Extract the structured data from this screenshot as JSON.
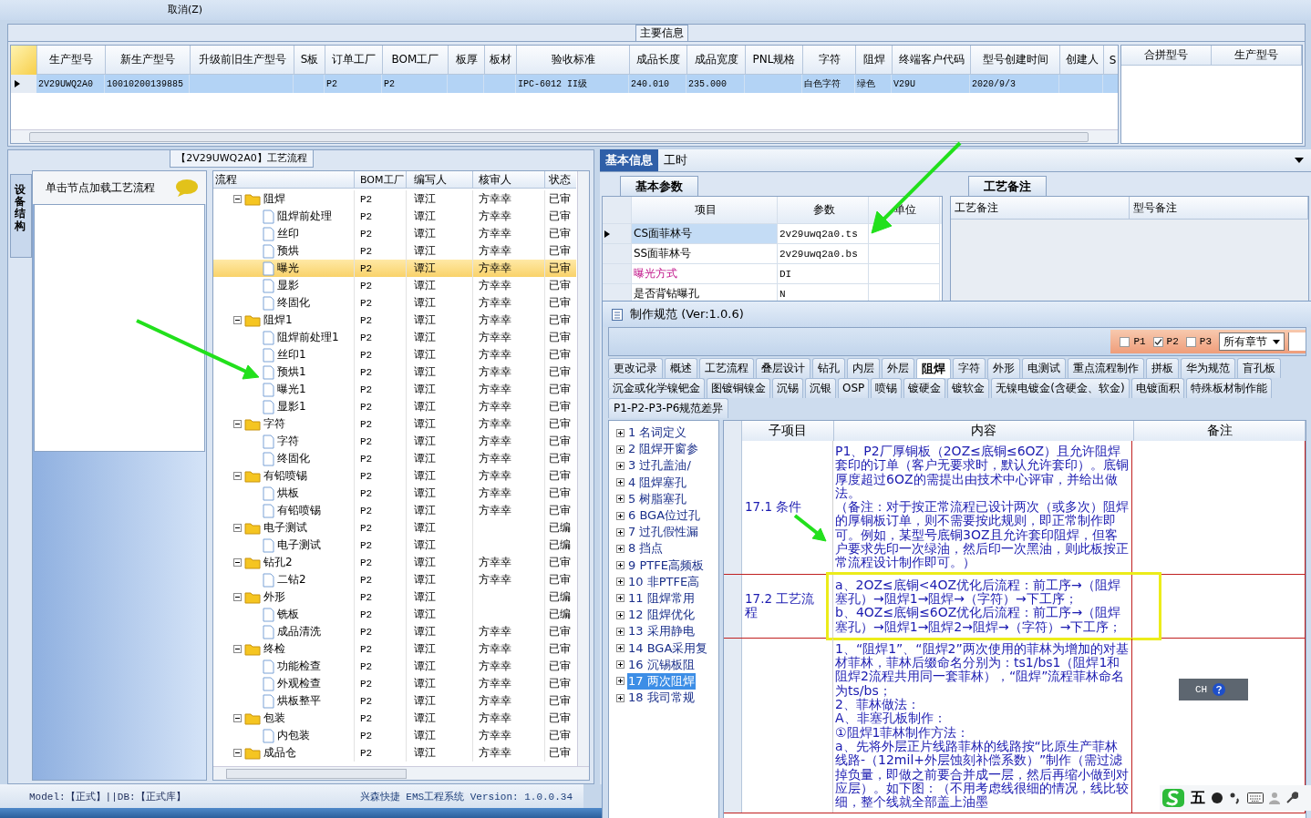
{
  "toolbar": {
    "cancel_button": "取消(Z)"
  },
  "main_info": {
    "tab": "主要信息",
    "columns": [
      "生产型号",
      "新生产型号",
      "升级前旧生产型号",
      "S板",
      "订单工厂",
      "BOM工厂",
      "板厚",
      "板材",
      "验收标准",
      "成品长度",
      "成品宽度",
      "PNL规格",
      "字符",
      "阻焊",
      "终端客户代码",
      "型号创建时间",
      "创建人",
      "S"
    ],
    "rows": [
      {
        "selected": true,
        "cells": [
          "2V29UWQ2A0",
          "10010200139885",
          null,
          null,
          "P2",
          "P2",
          null,
          null,
          "IPC-6012 II级",
          "240.010",
          "235.000",
          null,
          "白色字符",
          "绿色",
          "V29U",
          "2020/9/3",
          null,
          null
        ]
      }
    ],
    "merge_columns": [
      "合拼型号",
      "生产型号"
    ]
  },
  "process": {
    "title": "【2V29UWQ2A0】工艺流程",
    "side_tab": "设备结构",
    "hint": "单击节点加载工艺流程",
    "columns": [
      "流程",
      "BOM工厂",
      "编写人",
      "核审人",
      "状态"
    ],
    "tree": [
      {
        "name": "阻焊",
        "factory": "P2",
        "writer": "谭江",
        "reviewer": "方幸幸",
        "status": "已审",
        "selected": false,
        "children": [
          {
            "name": "阻焊前处理",
            "factory": "P2",
            "writer": "谭江",
            "reviewer": "方幸幸",
            "status": "已审",
            "selected": false
          },
          {
            "name": "丝印",
            "factory": "P2",
            "writer": "谭江",
            "reviewer": "方幸幸",
            "status": "已审",
            "selected": false
          },
          {
            "name": "预烘",
            "factory": "P2",
            "writer": "谭江",
            "reviewer": "方幸幸",
            "status": "已审",
            "selected": false
          },
          {
            "name": "曝光",
            "factory": "P2",
            "writer": "谭江",
            "reviewer": "方幸幸",
            "status": "已审",
            "selected": true
          },
          {
            "name": "显影",
            "factory": "P2",
            "writer": "谭江",
            "reviewer": "方幸幸",
            "status": "已审",
            "selected": false
          },
          {
            "name": "终固化",
            "factory": "P2",
            "writer": "谭江",
            "reviewer": "方幸幸",
            "status": "已审",
            "selected": false
          }
        ]
      },
      {
        "name": "阻焊1",
        "factory": "P2",
        "writer": "谭江",
        "reviewer": "方幸幸",
        "status": "已审",
        "selected": false,
        "children": [
          {
            "name": "阻焊前处理1",
            "factory": "P2",
            "writer": "谭江",
            "reviewer": "方幸幸",
            "status": "已审",
            "selected": false
          },
          {
            "name": "丝印1",
            "factory": "P2",
            "writer": "谭江",
            "reviewer": "方幸幸",
            "status": "已审",
            "selected": false
          },
          {
            "name": "预烘1",
            "factory": "P2",
            "writer": "谭江",
            "reviewer": "方幸幸",
            "status": "已审",
            "selected": false
          },
          {
            "name": "曝光1",
            "factory": "P2",
            "writer": "谭江",
            "reviewer": "方幸幸",
            "status": "已审",
            "selected": false
          },
          {
            "name": "显影1",
            "factory": "P2",
            "writer": "谭江",
            "reviewer": "方幸幸",
            "status": "已审",
            "selected": false
          }
        ]
      },
      {
        "name": "字符",
        "factory": "P2",
        "writer": "谭江",
        "reviewer": "方幸幸",
        "status": "已审",
        "selected": false,
        "children": [
          {
            "name": "字符",
            "factory": "P2",
            "writer": "谭江",
            "reviewer": "方幸幸",
            "status": "已审",
            "selected": false
          },
          {
            "name": "终固化",
            "factory": "P2",
            "writer": "谭江",
            "reviewer": "方幸幸",
            "status": "已审",
            "selected": false
          }
        ]
      },
      {
        "name": "有铅喷锡",
        "factory": "P2",
        "writer": "谭江",
        "reviewer": "方幸幸",
        "status": "已审",
        "selected": false,
        "children": [
          {
            "name": "烘板",
            "factory": "P2",
            "writer": "谭江",
            "reviewer": "方幸幸",
            "status": "已审",
            "selected": false
          },
          {
            "name": "有铅喷锡",
            "factory": "P2",
            "writer": "谭江",
            "reviewer": "方幸幸",
            "status": "已审",
            "selected": false
          }
        ]
      },
      {
        "name": "电子测试",
        "factory": "P2",
        "writer": "谭江",
        "status": "已编",
        "selected": false,
        "children": [
          {
            "name": "电子测试",
            "factory": "P2",
            "writer": "谭江",
            "status": "已编",
            "selected": false
          }
        ]
      },
      {
        "name": "钻孔2",
        "factory": "P2",
        "writer": "谭江",
        "reviewer": "方幸幸",
        "status": "已审",
        "selected": false,
        "children": [
          {
            "name": "二钻2",
            "factory": "P2",
            "writer": "谭江",
            "reviewer": "方幸幸",
            "status": "已审",
            "selected": false
          }
        ]
      },
      {
        "name": "外形",
        "factory": "P2",
        "writer": "谭江",
        "status": "已编",
        "selected": false,
        "children": [
          {
            "name": "铣板",
            "factory": "P2",
            "writer": "谭江",
            "status": "已编",
            "selected": false
          },
          {
            "name": "成品清洗",
            "factory": "P2",
            "writer": "谭江",
            "reviewer": "方幸幸",
            "status": "已审",
            "selected": false
          }
        ]
      },
      {
        "name": "终检",
        "factory": "P2",
        "writer": "谭江",
        "reviewer": "方幸幸",
        "status": "已审",
        "selected": false,
        "children": [
          {
            "name": "功能检查",
            "factory": "P2",
            "writer": "谭江",
            "reviewer": "方幸幸",
            "status": "已审",
            "selected": false
          },
          {
            "name": "外观检查",
            "factory": "P2",
            "writer": "谭江",
            "reviewer": "方幸幸",
            "status": "已审",
            "selected": false
          },
          {
            "name": "烘板整平",
            "factory": "P2",
            "writer": "谭江",
            "reviewer": "方幸幸",
            "status": "已审",
            "selected": false
          }
        ]
      },
      {
        "name": "包装",
        "factory": "P2",
        "writer": "谭江",
        "reviewer": "方幸幸",
        "status": "已审",
        "selected": false,
        "children": [
          {
            "name": "内包装",
            "factory": "P2",
            "writer": "谭江",
            "reviewer": "方幸幸",
            "status": "已审",
            "selected": false
          }
        ]
      },
      {
        "name": "成品仓",
        "factory": "P2",
        "writer": "谭江",
        "reviewer": "方幸幸",
        "status": "已审",
        "selected": false
      }
    ]
  },
  "detail": {
    "tabs": [
      {
        "label": "基本信息",
        "selected": true
      },
      {
        "label": "工时",
        "selected": false
      }
    ],
    "params_tab": "基本参数",
    "param_columns": [
      "项目",
      "参数",
      "单位"
    ],
    "params": [
      {
        "item": "CS面菲林号",
        "value": "2v29uwq2a0.ts",
        "selected": true,
        "emphasis": false
      },
      {
        "item": "SS面菲林号",
        "value": "2v29uwq2a0.bs",
        "selected": false,
        "emphasis": false
      },
      {
        "item": "曝光方式",
        "value": "DI",
        "selected": false,
        "emphasis": true
      },
      {
        "item": "是否背钻曝孔",
        "value": "N",
        "selected": false,
        "emphasis": false
      }
    ],
    "notes_tab": "工艺备注",
    "note_columns": [
      "工艺备注",
      "型号备注"
    ]
  },
  "spec_window": {
    "title": "制作规范 (Ver:1.0.6)",
    "filters": [
      {
        "label": "P1",
        "checked": false
      },
      {
        "label": "P2",
        "checked": true
      },
      {
        "label": "P3",
        "checked": false
      }
    ],
    "chapter_select": "所有章节",
    "tab_rows": [
      [
        {
          "label": "更改记录",
          "selected": false
        },
        {
          "label": "概述",
          "selected": false
        },
        {
          "label": "工艺流程",
          "selected": false
        },
        {
          "label": "叠层设计",
          "selected": false
        },
        {
          "label": "钻孔",
          "selected": false
        },
        {
          "label": "内层",
          "selected": false
        },
        {
          "label": "外层",
          "selected": false
        },
        {
          "label": "阻焊",
          "selected": true
        },
        {
          "label": "字符",
          "selected": false
        },
        {
          "label": "外形",
          "selected": false
        },
        {
          "label": "电测试",
          "selected": false
        },
        {
          "label": "重点流程制作",
          "selected": false
        },
        {
          "label": "拼板",
          "selected": false
        },
        {
          "label": "华为规范",
          "selected": false
        },
        {
          "label": "盲孔板",
          "selected": false
        }
      ],
      [
        {
          "label": "沉金或化学镍钯金",
          "selected": false
        },
        {
          "label": "图镀铜镍金",
          "selected": false
        },
        {
          "label": "沉锡",
          "selected": false
        },
        {
          "label": "沉银",
          "selected": false
        },
        {
          "label": "OSP",
          "selected": false
        },
        {
          "label": "喷锡",
          "selected": false
        },
        {
          "label": "镀硬金",
          "selected": false
        },
        {
          "label": "镀软金",
          "selected": false
        },
        {
          "label": "无镍电镀金(含硬金、软金)",
          "selected": false
        },
        {
          "label": "电镀面积",
          "selected": false
        },
        {
          "label": "特殊板材制作能",
          "selected": false
        }
      ],
      [
        {
          "label": "P1-P2-P3-P6规范差异",
          "selected": false
        }
      ]
    ],
    "chapters": [
      {
        "number": "1",
        "title": "名词定义",
        "selected": false
      },
      {
        "number": "2",
        "title": "阻焊开窗参",
        "selected": false
      },
      {
        "number": "3",
        "title": "过孔盖油/",
        "selected": false
      },
      {
        "number": "4",
        "title": "阻焊塞孔",
        "selected": false
      },
      {
        "number": "5",
        "title": "树脂塞孔",
        "selected": false
      },
      {
        "number": "6",
        "title": "BGA位过孔",
        "selected": false
      },
      {
        "number": "7",
        "title": "过孔假性漏",
        "selected": false
      },
      {
        "number": "8",
        "title": "挡点",
        "selected": false
      },
      {
        "number": "9",
        "title": "PTFE高频板",
        "selected": false
      },
      {
        "number": "10",
        "title": "非PTFE高",
        "selected": false
      },
      {
        "number": "11",
        "title": "阻焊常用",
        "selected": false
      },
      {
        "number": "12",
        "title": "阻焊优化",
        "selected": false
      },
      {
        "number": "13",
        "title": "采用静电",
        "selected": false
      },
      {
        "number": "14",
        "title": "BGA采用复",
        "selected": false
      },
      {
        "number": "16",
        "title": "沉锡板阻",
        "selected": false
      },
      {
        "number": "17",
        "title": "两次阻焊",
        "selected": true
      },
      {
        "number": "18",
        "title": "我司常规",
        "selected": false
      }
    ],
    "columns": [
      "子项目",
      "内容",
      "备注"
    ],
    "rows": [
      {
        "sub": "17.1 条件",
        "content": [
          "P1、P2厂厚铜板（2OZ≤底铜≤6OZ）且允许阻焊套印的订单（客户无要求时，默认允许套印）。底铜厚度超过6OZ的需提出由技术中心评审，并给出做法。",
          "（备注：对于按正常流程已设计两次（或多次）阻焊的厚铜板订单，则不需要按此规则，即正常制作即可。例如，某型号底铜3OZ且允许套印阻焊，但客户要求先印一次绿油，然后印一次黑油，则此板按正常流程设计制作即可。）"
        ]
      },
      {
        "sub": "17.2 工艺流程",
        "content": [
          "a、2OZ≤底铜<4OZ优化后流程：前工序→（阻焊塞孔）→阻焊1→阻焊→（字符）→下工序；",
          "b、4OZ≤底铜≤6OZ优化后流程：前工序→（阻焊塞孔）→阻焊1→阻焊2→阻焊→（字符）→下工序；"
        ]
      },
      {
        "content": [
          "1、“阻焊1”、“阻焊2”两次使用的菲林为增加的对基材菲林，菲林后缀命名分别为：ts1/bs1（阻焊1和阻焊2流程共用同一套菲林），“阻焊”流程菲林命名为ts/bs；",
          "2、菲林做法：",
          "A、非塞孔板制作：",
          "①阻焊1菲林制作方法：",
          "a、先将外层正片线路菲林的线路按“比原生产菲林线路-（12mil+外层蚀刻补偿系数）”制作（需过滤掉负量，即做之前要合并成一层，然后再缩小做到对应层）。如下图：（不用考虑线很细的情况，线比较细，整个线就全部盖上油墨"
        ]
      }
    ]
  },
  "ime": {
    "language": "CH",
    "mode": "五"
  },
  "status_bar": {
    "left": "Model:【正式】||DB:【正式库】",
    "right": "兴森快捷 EMS工程系统 Version: 1.0.0.34"
  }
}
